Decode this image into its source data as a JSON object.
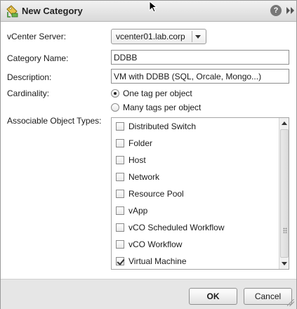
{
  "window": {
    "title": "New Category",
    "help_glyph": "?"
  },
  "form": {
    "vcenter_label": "vCenter Server:",
    "vcenter_value": "vcenter01.lab.corp",
    "name_label": "Category Name:",
    "name_value": "DDBB",
    "description_label": "Description:",
    "description_value": "VM with DDBB (SQL, Orcale, Mongo...)",
    "cardinality_label": "Cardinality:",
    "cardinality_options": [
      {
        "label": "One tag per object",
        "selected": true
      },
      {
        "label": "Many tags per object",
        "selected": false
      }
    ],
    "object_types_label": "Associable Object Types:",
    "object_types": [
      {
        "label": "Distributed Switch",
        "checked": false
      },
      {
        "label": "Folder",
        "checked": false
      },
      {
        "label": "Host",
        "checked": false
      },
      {
        "label": "Network",
        "checked": false
      },
      {
        "label": "Resource Pool",
        "checked": false
      },
      {
        "label": "vApp",
        "checked": false
      },
      {
        "label": "vCO Scheduled Workflow",
        "checked": false
      },
      {
        "label": "vCO Workflow",
        "checked": false
      },
      {
        "label": "Virtual Machine",
        "checked": true
      }
    ]
  },
  "footer": {
    "ok_label": "OK",
    "cancel_label": "Cancel"
  },
  "icons": {
    "title": "tag-category-icon",
    "help": "help-icon",
    "expand": "double-chevron-right-icon"
  }
}
